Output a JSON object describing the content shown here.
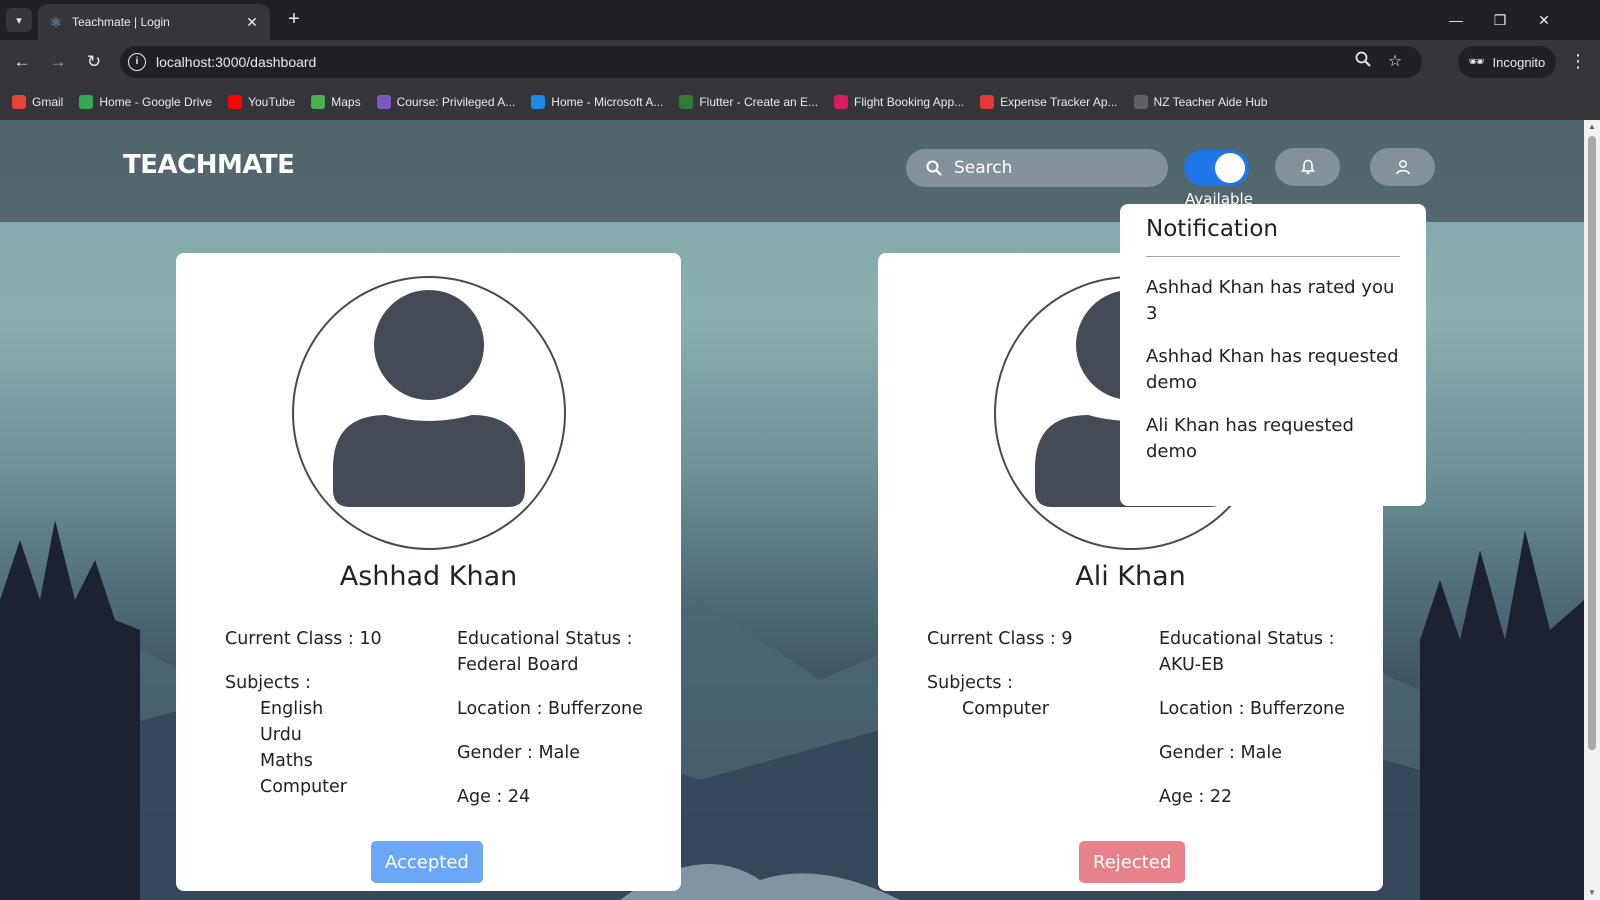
{
  "browser": {
    "tab_title": "Teachmate | Login",
    "url": "localhost:3000/dashboard",
    "incognito_label": "Incognito",
    "bookmarks": [
      {
        "label": "Gmail",
        "color": "#ea4335"
      },
      {
        "label": "Home - Google Drive",
        "color": "#34a853"
      },
      {
        "label": "YouTube",
        "color": "#ff0000"
      },
      {
        "label": "Maps",
        "color": "#4caf50"
      },
      {
        "label": "Course: Privileged A...",
        "color": "#7e57c2"
      },
      {
        "label": "Home - Microsoft A...",
        "color": "#1e88e5"
      },
      {
        "label": "Flutter - Create an E...",
        "color": "#2e7d32"
      },
      {
        "label": "Flight Booking App...",
        "color": "#d81b60"
      },
      {
        "label": "Expense Tracker Ap...",
        "color": "#e53935"
      },
      {
        "label": "NZ Teacher Aide Hub",
        "color": "#616161"
      }
    ]
  },
  "header": {
    "brand": "TEACHMATE",
    "search_placeholder": "Search",
    "availability_label": "Available",
    "availability_on": true
  },
  "students": [
    {
      "name": "Ashhad Khan",
      "current_class": "Current Class : 10",
      "subjects_label": "Subjects :",
      "subjects": [
        "English",
        "Urdu",
        "Maths",
        "Computer"
      ],
      "education_label": "Educational Status :",
      "education_value": "Federal Board",
      "location": "Location : Bufferzone",
      "gender": "Gender : Male",
      "age": "Age : 24",
      "status": "Accepted",
      "status_color": "#6aa8f7"
    },
    {
      "name": "Ali Khan",
      "current_class": "Current Class : 9",
      "subjects_label": "Subjects :",
      "subjects": [
        "Computer"
      ],
      "education_label": "Educational Status :",
      "education_value": "AKU-EB",
      "location": "Location : Bufferzone",
      "gender": "Gender : Male",
      "age": "Age : 22",
      "status": "Rejected",
      "status_color": "#e8828a"
    }
  ],
  "notifications": {
    "title": "Notification",
    "items": [
      "Ashhad Khan has rated you 3",
      "Ashhad Khan has requested demo",
      "Ali Khan has requested demo"
    ]
  },
  "colors": {
    "accent": "#1f76e8",
    "avatar": "#454a57"
  }
}
